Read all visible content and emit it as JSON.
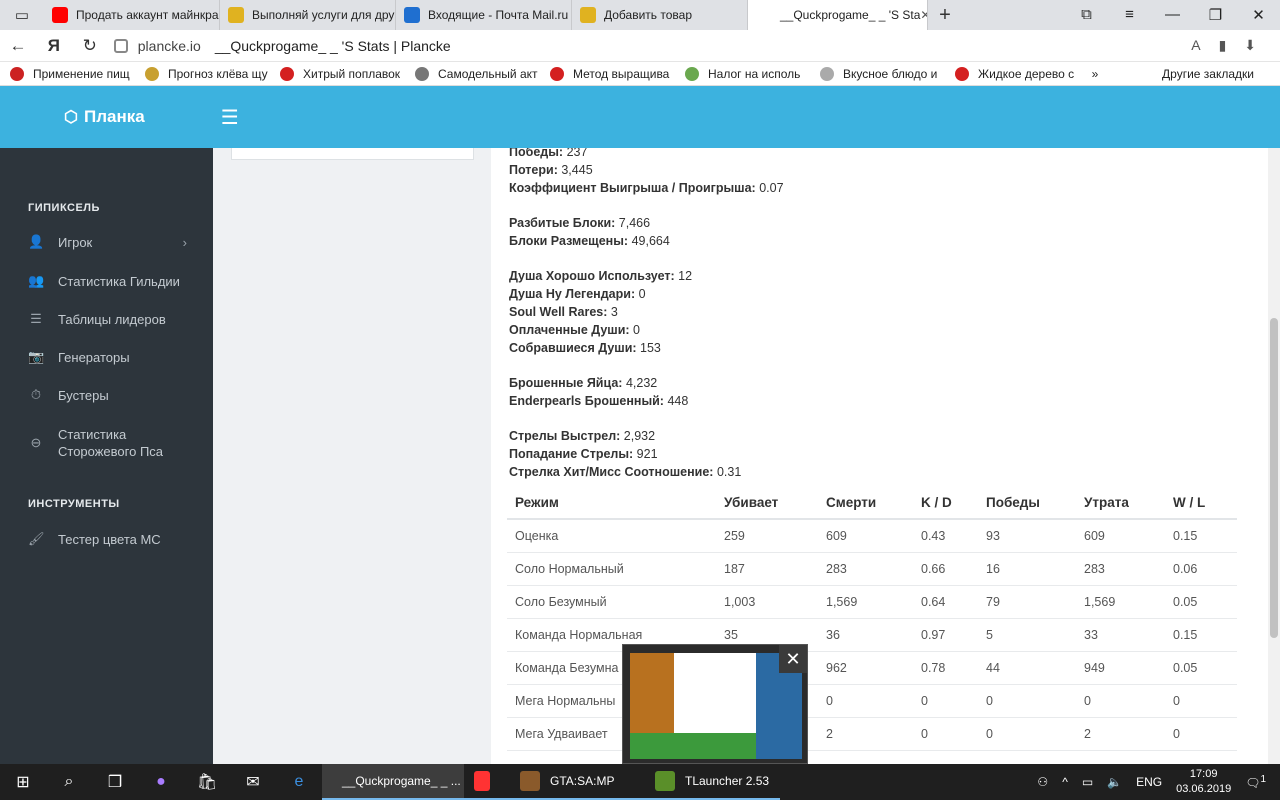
{
  "browser": {
    "tabs": [
      {
        "title": "Продать аккаунт майнкра",
        "icon": "yandex-icon",
        "color": "#ff0000"
      },
      {
        "title": "Выполняй услуги для дру",
        "icon": "coin-icon",
        "color": "#e0b220"
      },
      {
        "title": "Входящие - Почта Mail.ru",
        "icon": "mail-icon",
        "color": "#1f6fd0"
      },
      {
        "title": "Добавить товар",
        "icon": "coin-icon",
        "color": "#e0b220"
      },
      {
        "title": "__Quckprogame_ _ 'S Sta",
        "icon": "page-icon",
        "color": "#ffffff",
        "active": true
      }
    ],
    "new_tab": "+",
    "url_host": "plancke.io",
    "url_title": "__Quckprogame_ _ 'S Stats | Plancke",
    "bookmarks": [
      {
        "label": "Применение пищ",
        "color": "#cc2222"
      },
      {
        "label": "Прогноз клёва щу",
        "color": "#c8a030"
      },
      {
        "label": "Хитрый поплавок",
        "color": "#d42020"
      },
      {
        "label": "Самодельный акт",
        "color": "#777777"
      },
      {
        "label": "Метод выращива",
        "color": "#d42020"
      },
      {
        "label": "Налог на исполь",
        "color": "#6aa84f"
      },
      {
        "label": "Вкусное блюдо и",
        "color": "#aaaaaa"
      },
      {
        "label": "Жидкое дерево с",
        "color": "#d42020"
      }
    ],
    "bookmarks_more": "»",
    "other_bookmarks": "Другие закладки"
  },
  "header": {
    "logo": "Планка"
  },
  "sidebar": {
    "section1": "ГИПИКСЕЛЬ",
    "items1": [
      {
        "label": "Игрок",
        "icon": "user-icon",
        "chevron": true
      },
      {
        "label": "Статистика Гильдии",
        "icon": "users-icon"
      },
      {
        "label": "Таблицы лидеров",
        "icon": "list-icon"
      },
      {
        "label": "Генераторы",
        "icon": "camera-icon"
      },
      {
        "label": "Бустеры",
        "icon": "stopwatch-icon"
      },
      {
        "label": "Статистика Сторожевого Пса",
        "icon": "minus-circle-icon"
      }
    ],
    "section2": "ИНСТРУМЕНТЫ",
    "items2": [
      {
        "label": "Тестер цвета МС",
        "icon": "brush-icon"
      }
    ]
  },
  "stats": [
    {
      "label": "Победы:",
      "value": "237"
    },
    {
      "label": "Потери:",
      "value": "3,445"
    },
    {
      "label": "Коэффициент Выигрыша / Проигрыша:",
      "value": "0.07"
    },
    {
      "label": "Разбитые Блоки:",
      "value": "7,466"
    },
    {
      "label": "Блоки Размещены:",
      "value": "49,664"
    },
    {
      "label": "Душа Хорошо Использует:",
      "value": "12"
    },
    {
      "label": "Душа Ну Легендари:",
      "value": "0"
    },
    {
      "label": "Soul Well Rares:",
      "value": "3"
    },
    {
      "label": "Оплаченные Души:",
      "value": "0"
    },
    {
      "label": "Собравшиеся Души:",
      "value": "153"
    },
    {
      "label": "Брошенные Яйца:",
      "value": "4,232"
    },
    {
      "label": "Enderpearls Брошенный:",
      "value": "448"
    },
    {
      "label": "Стрелы Выстрел:",
      "value": "2,932"
    },
    {
      "label": "Попадание Стрелы:",
      "value": "921"
    },
    {
      "label": "Стрелка Хит/Мисс Соотношение:",
      "value": "0.31"
    }
  ],
  "table": {
    "headers": [
      "Режим",
      "Убивает",
      "Смерти",
      "K / D",
      "Победы",
      "Утрата",
      "W / L"
    ],
    "rows": [
      [
        "Оценка",
        "259",
        "609",
        "0.43",
        "93",
        "609",
        "0.15"
      ],
      [
        "Соло Нормальный",
        "187",
        "283",
        "0.66",
        "16",
        "283",
        "0.06"
      ],
      [
        "Соло Безумный",
        "1,003",
        "1,569",
        "0.64",
        "79",
        "1,569",
        "0.05"
      ],
      [
        "Команда Нормальная",
        "35",
        "36",
        "0.97",
        "5",
        "33",
        "0.15"
      ],
      [
        "Команда Безумна",
        "",
        "962",
        "0.78",
        "44",
        "949",
        "0.05"
      ],
      [
        "Мега Нормальны",
        "",
        "0",
        "0",
        "0",
        "0",
        "0"
      ],
      [
        "Мега Удваивает",
        "",
        "2",
        "0",
        "0",
        "2",
        "0"
      ]
    ]
  },
  "taskbar": {
    "apps": [
      {
        "label": "__Quckprogame_ _ ...",
        "color": "#ff3333",
        "active": true
      },
      {
        "label": "",
        "color": "#ff3333"
      },
      {
        "label": "GTA:SA:MP",
        "color": "#8a5a2b"
      },
      {
        "label": "TLauncher 2.53",
        "color": "#5a8f29"
      }
    ],
    "lang": "ENG",
    "time": "17:09",
    "date": "03.06.2019",
    "notif_count": "1"
  }
}
